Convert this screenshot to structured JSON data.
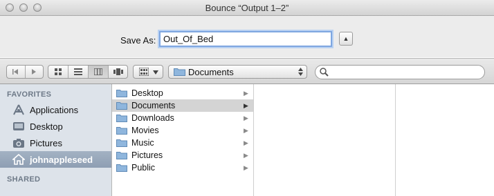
{
  "window": {
    "title": "Bounce “Output 1–2”"
  },
  "save": {
    "label": "Save As:",
    "value": "Out_Of_Bed",
    "expand_glyph": "▲"
  },
  "toolbar": {
    "location_popup": "Documents",
    "view_modes": [
      "icon",
      "list",
      "column",
      "coverflow"
    ],
    "active_view": "column"
  },
  "sidebar": {
    "favorites_header": "FAVORITES",
    "shared_header": "SHARED",
    "items": [
      {
        "label": "Applications",
        "icon": "applications-icon"
      },
      {
        "label": "Desktop",
        "icon": "desktop-icon"
      },
      {
        "label": "Pictures",
        "icon": "camera-icon"
      },
      {
        "label": "johnappleseed",
        "icon": "home-icon",
        "selected": true
      }
    ]
  },
  "column1": {
    "items": [
      {
        "label": "Desktop"
      },
      {
        "label": "Documents",
        "selected": true
      },
      {
        "label": "Downloads"
      },
      {
        "label": "Movies"
      },
      {
        "label": "Music"
      },
      {
        "label": "Pictures"
      },
      {
        "label": "Public"
      }
    ]
  },
  "colors": {
    "selection_sidebar": "#95a5b8",
    "selection_column": "#d4d4d4",
    "folder": "#8fb6dd"
  }
}
